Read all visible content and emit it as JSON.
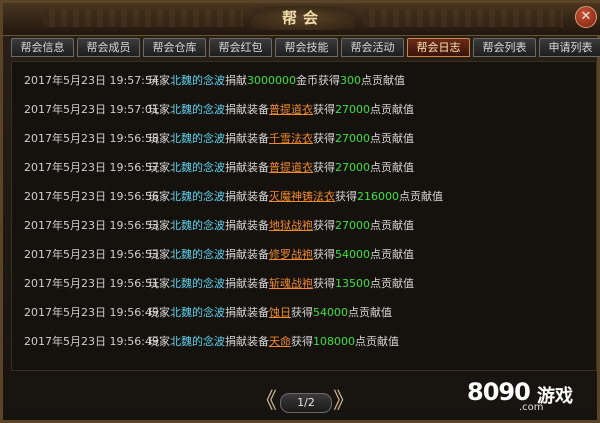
{
  "window": {
    "title": "帮会",
    "close_glyph": "✕"
  },
  "tabs": [
    {
      "label": "帮会信息"
    },
    {
      "label": "帮会成员"
    },
    {
      "label": "帮会仓库"
    },
    {
      "label": "帮会红包"
    },
    {
      "label": "帮会技能"
    },
    {
      "label": "帮会活动"
    },
    {
      "label": "帮会日志",
      "active": true
    },
    {
      "label": "帮会列表"
    },
    {
      "label": "申请列表"
    }
  ],
  "log": [
    {
      "time": "2017年5月23日  19:57:54",
      "p1": "玩家",
      "name": "北魏的念波",
      "p2": "捐献",
      "num": "3000000",
      "p3": "金币获得",
      "pts": "300",
      "p4": "点贡献值"
    },
    {
      "time": "2017年5月23日  19:57:01",
      "p1": "玩家",
      "name": "北魏的念波",
      "p2": "捐献装备",
      "item": "普提道衣",
      "p3": "获得",
      "pts": "27000",
      "p4": "点贡献值"
    },
    {
      "time": "2017年5月23日  19:56:58",
      "p1": "玩家",
      "name": "北魏的念波",
      "p2": "捐献装备",
      "item": "千雪法衣",
      "p3": "获得",
      "pts": "27000",
      "p4": "点贡献值"
    },
    {
      "time": "2017年5月23日  19:56:57",
      "p1": "玩家",
      "name": "北魏的念波",
      "p2": "捐献装备",
      "item": "普提道衣",
      "p3": "获得",
      "pts": "27000",
      "p4": "点贡献值"
    },
    {
      "time": "2017年5月23日  19:56:56",
      "p1": "玩家",
      "name": "北魏的念波",
      "p2": "捐献装备",
      "item": "灭魔神铸法衣",
      "p3": "获得",
      "pts": "216000",
      "p4": "点贡献值"
    },
    {
      "time": "2017年5月23日  19:56:53",
      "p1": "玩家",
      "name": "北魏的念波",
      "p2": "捐献装备",
      "item": "地狱战袍",
      "p3": "获得",
      "pts": "27000",
      "p4": "点贡献值"
    },
    {
      "time": "2017年5月23日  19:56:53",
      "p1": "玩家",
      "name": "北魏的念波",
      "p2": "捐献装备",
      "item": "修罗战袍",
      "p3": "获得",
      "pts": "54000",
      "p4": "点贡献值"
    },
    {
      "time": "2017年5月23日  19:56:51",
      "p1": "玩家",
      "name": "北魏的念波",
      "p2": "捐献装备",
      "item": "斩魂战袍",
      "p3": "获得",
      "pts": "13500",
      "p4": "点贡献值"
    },
    {
      "time": "2017年5月23日  19:56:49",
      "p1": "玩家",
      "name": "北魏的念波",
      "p2": "捐献装备",
      "item": "蚀日",
      "p3": "获得",
      "pts": "54000",
      "p4": "点贡献值"
    },
    {
      "time": "2017年5月23日  19:56:49",
      "p1": "玩家",
      "name": "北魏的念波",
      "p2": "捐献装备",
      "item": "天命",
      "p3": "获得",
      "pts": "108000",
      "p4": "点贡献值"
    }
  ],
  "pager": {
    "prev_glyph": "《",
    "label": "1/2",
    "next_glyph": "》"
  },
  "brand": {
    "digits": "8090",
    "cn": "游戏",
    "com": ".com"
  },
  "colors": {
    "name": "#5fd4f0",
    "number": "#3be23b",
    "item": "#f08a2a",
    "active_tab": "#6b2a18"
  }
}
